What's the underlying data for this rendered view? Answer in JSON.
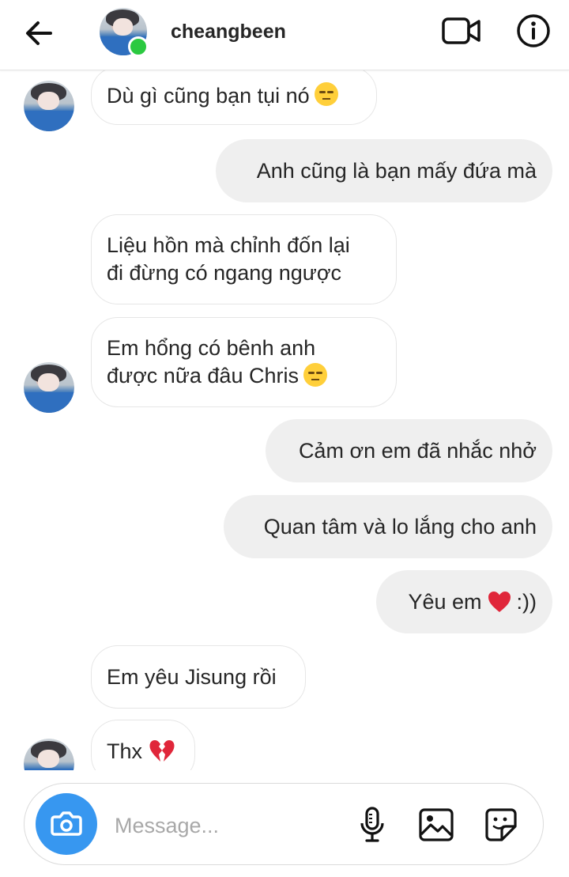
{
  "header": {
    "username": "cheangbeen",
    "back_icon": "arrow-left-icon",
    "video_icon": "video-camera-icon",
    "info_icon": "info-icon",
    "online_color": "#2bc940"
  },
  "messages": [
    {
      "sender": "them",
      "text": "Dù gì cũng bạn tụi nó",
      "emoji": "unamused-face"
    },
    {
      "sender": "me",
      "text": "Anh cũng là bạn mấy đứa mà"
    },
    {
      "sender": "them",
      "lines": [
        "Liệu hồn mà chỉnh đốn lại",
        "đi đừng có ngang ngược"
      ]
    },
    {
      "sender": "them",
      "lines": [
        "Em hổng có bênh anh",
        "được nữa đâu Chris"
      ],
      "emoji": "unamused-face"
    },
    {
      "sender": "me",
      "text": "Cảm ơn em đã nhắc nhở"
    },
    {
      "sender": "me",
      "text": "Quan tâm và lo lắng cho anh"
    },
    {
      "sender": "me",
      "text": "Yêu em",
      "emoji": "red-heart",
      "suffix": ":))"
    },
    {
      "sender": "them",
      "text": "Em yêu Jisung rồi"
    },
    {
      "sender": "them",
      "text": "Thx",
      "emoji": "broken-heart"
    }
  ],
  "composer": {
    "placeholder": "Message...",
    "camera_icon": "camera-icon",
    "mic_icon": "microphone-icon",
    "gallery_icon": "image-icon",
    "sticker_icon": "sticker-icon",
    "accent_color": "#3797f0"
  },
  "colors": {
    "outgoing_bubble": "#efefef",
    "incoming_border": "#e6e6e6",
    "heart": "#e0263a"
  }
}
